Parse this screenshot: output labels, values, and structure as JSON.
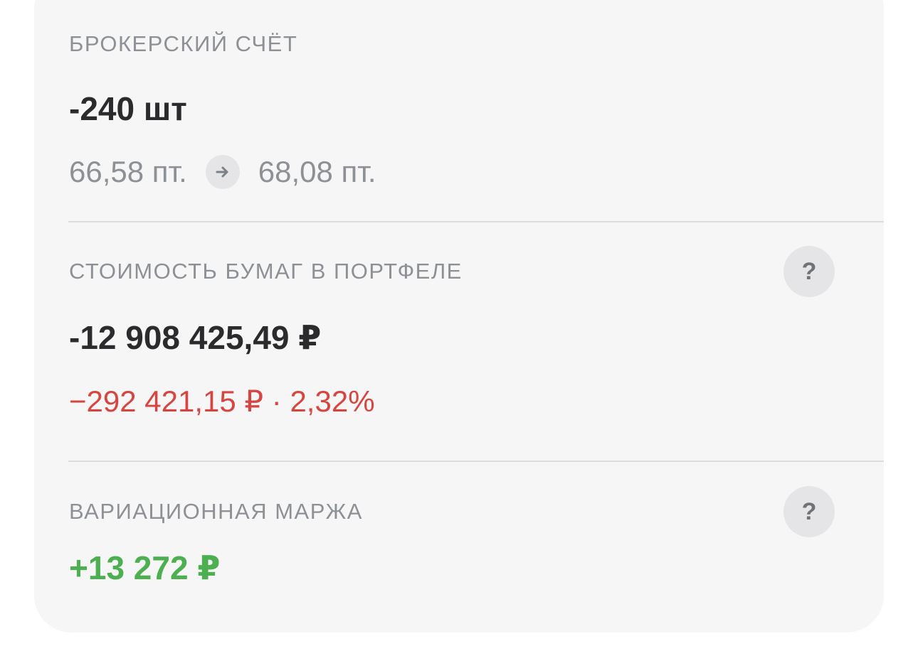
{
  "broker": {
    "label": "Брокерский счёт",
    "quantity": "-240 шт",
    "price_from": "66,58 пт.",
    "price_to": "68,08 пт.",
    "arrow_icon": "arrow-right-icon"
  },
  "portfolio": {
    "label": "Стоимость бумаг в портфеле",
    "value": "-12 908 425,49 ₽",
    "change": "−292 421,15 ₽ · 2,32%",
    "change_color": "#d64540",
    "help_symbol": "?"
  },
  "margin": {
    "label": "Вариационная маржа",
    "value": "+13 272 ₽",
    "value_color": "#4caf50",
    "help_symbol": "?"
  }
}
